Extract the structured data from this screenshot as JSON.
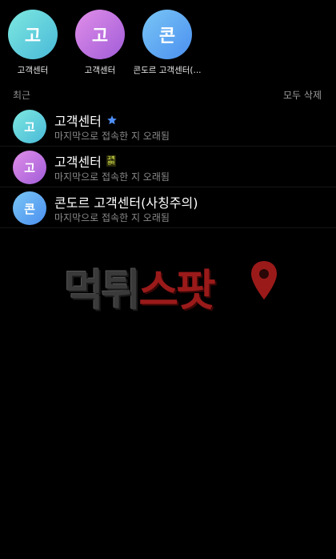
{
  "top_contacts": [
    {
      "initial": "고",
      "name": "고객센터",
      "gradient": [
        "#7de8e0",
        "#49b9d8"
      ]
    },
    {
      "initial": "고",
      "name": "고객센터",
      "gradient": [
        "#e08ee8",
        "#a15cd8"
      ]
    },
    {
      "initial": "콘",
      "name": "콘도르 고객센터(...",
      "gradient": [
        "#79c6f5",
        "#4b8ff0"
      ]
    }
  ],
  "recent": {
    "section_title": "최근",
    "delete_all_label": "모두 삭제",
    "items": [
      {
        "initial": "고",
        "name": "고객센터",
        "status": "마지막으로 접속한 지 오래됨",
        "badge": "star-icon",
        "gradient": [
          "#7de8e0",
          "#49b9d8"
        ]
      },
      {
        "initial": "고",
        "name": "고객센터",
        "status": "마지막으로 접속한 지 오래됨",
        "badge": "small-logo-icon",
        "badge_text": [
          "고객",
          "센터"
        ],
        "gradient": [
          "#e08ee8",
          "#a15cd8"
        ]
      },
      {
        "initial": "콘",
        "name": "콘도르 고객센터(사칭주의)",
        "status": "마지막으로 접속한 지 오래됨",
        "badge": "",
        "gradient": [
          "#79c6f5",
          "#4b8ff0"
        ]
      }
    ]
  },
  "watermark": {
    "part1": "먹튀",
    "part2": "스팟",
    "pin_icon": "location-pin-icon",
    "colors": {
      "dark": "#3a3a3a",
      "red": "#9a1a1a"
    }
  },
  "colors": {
    "background": "#000000",
    "muted_text": "#8a8a8a",
    "star": "#4f8ff7"
  }
}
